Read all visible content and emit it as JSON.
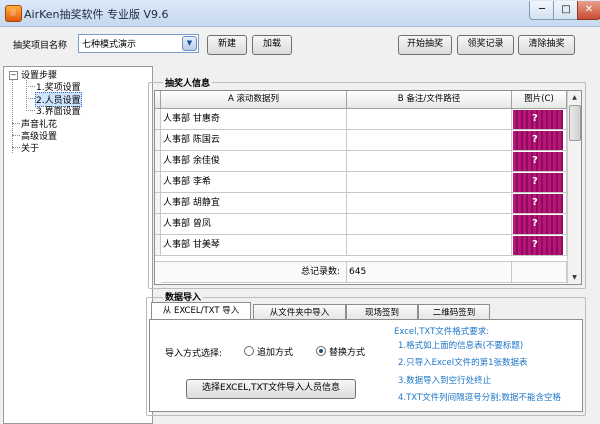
{
  "window": {
    "title": "AirKen抽奖软件 专业版 V9.6",
    "min": "─",
    "max": "□",
    "close": "✕"
  },
  "top": {
    "project_label": "抽奖项目名称",
    "project_value": "七种模式演示",
    "new_button": "新建",
    "load_button": "加载",
    "start_button": "开始抽奖",
    "records_button": "领奖记录",
    "clear_button": "清除抽奖"
  },
  "tree": {
    "root": "设置步骤",
    "toggle": "−",
    "children": [
      "1.奖项设置",
      "2.人员设置",
      "3.界面设置"
    ],
    "others": [
      "声音礼花",
      "高级设置",
      "关于"
    ]
  },
  "people": {
    "section_title": "抽奖人信息",
    "columns": [
      "A 滚动数据列",
      "B 备注/文件路径",
      "图片(C)"
    ],
    "rows": [
      {
        "a": "人事部 甘惠奇",
        "b": ""
      },
      {
        "a": "人事部 陈国云",
        "b": ""
      },
      {
        "a": "人事部 余佳俊",
        "b": ""
      },
      {
        "a": "人事部 李希",
        "b": ""
      },
      {
        "a": "人事部 胡静宜",
        "b": ""
      },
      {
        "a": "人事部 曾凤",
        "b": ""
      },
      {
        "a": "人事部 甘美琴",
        "b": ""
      }
    ],
    "pic_glyph": "?",
    "total_label": "总记录数:",
    "total_value": "645"
  },
  "import": {
    "section_title": "数据导入",
    "tabs": [
      "从 EXCEL/TXT 导入",
      "从文件夹中导入",
      "现场签到",
      "二维码签到"
    ],
    "mode_label": "导入方式选择:",
    "option_append": "追加方式",
    "option_replace": "替换方式",
    "selected_option": "替换方式",
    "import_button": "选择EXCEL,TXT文件导入人员信息",
    "notes": [
      "Excel,TXT文件格式要求:",
      "1.格式如上面的信息表(不要标题)",
      "2.只导入Excel文件的第1张数据表",
      "3.数据导入到空行处终止",
      "4.TXT文件列间隔逗号分割;数据不能含空格"
    ]
  }
}
